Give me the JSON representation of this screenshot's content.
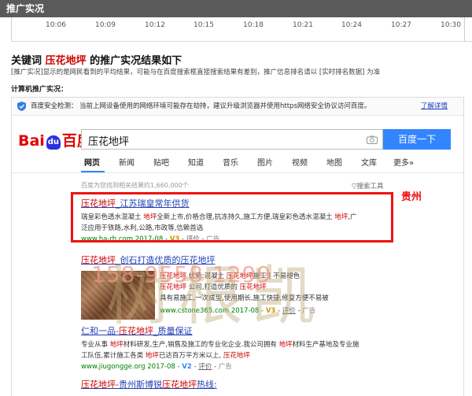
{
  "header": {
    "title": "推广实况"
  },
  "timeline": {
    "ticks": [
      "10:06",
      "10:09",
      "10:12",
      "10:15",
      "10:18",
      "10:21",
      "10:24",
      "10:27",
      "10:30"
    ]
  },
  "result_heading": {
    "prefix": "关键词 ",
    "keyword": "压花地坪",
    "suffix": " 的推广实况结果如下"
  },
  "notice": "[推广实况]显示的是网民看到的平均结果，可能与在百度搜索框直接搜索结果有差别，推广信息排名请以 [实时排名数据] 为准",
  "subheading": "计算机推广实况：",
  "security_bar": {
    "label": "百度安全检测：",
    "message": "当前上网设备使用的网络环境可能存在劫持，建议升级浏览器并使用https网络安全协议访问百度。",
    "link": "了解详情"
  },
  "baidu": {
    "logo_bai": "Bai",
    "logo_du": "du",
    "logo_cn": "百度",
    "query": "压花地坪",
    "search_button": "百度一下",
    "tabs": [
      "网页",
      "新闻",
      "贴吧",
      "知道",
      "音乐",
      "图片",
      "视频",
      "地图",
      "文库",
      "更多»"
    ],
    "result_count": "百度为您找到相关结果约1,660,000个",
    "search_tools": "搜索工具"
  },
  "annotation": {
    "region_label": "贵州"
  },
  "watermark": {
    "text": "树根凯",
    "phone": "158-9558-1299"
  },
  "results": [
    {
      "title_hl": "压花地坪",
      "title_rest": "_江苏瑞皇常年供货",
      "desc1_a": "瑞皇彩色透水混凝土 ",
      "desc1_hl": "地坪",
      "desc1_b": "全新上市,价格合理,抗冻持久,施工方便,瑞皇彩色透水混凝土 ",
      "desc1_hl2": "地坪",
      "desc1_c": ",广",
      "desc2": "泛应用于铁路,水利,公路,市政等,信赖首选",
      "url": "www.ha-rh.com",
      "date": "2017-08",
      "vbadge": "V3",
      "eval": "评价",
      "ad": "广告"
    },
    {
      "title_hl": "压花地坪",
      "title_rest": "_创石打造优质的压花地坪",
      "desc1_a": "",
      "desc1_hl": "压花地坪",
      "desc1_b": " 优势:混凝土 ",
      "desc1_hl2": "压花地坪",
      "desc1_c": "施工 | 不易褪色",
      "desc2_hl": "压花地坪",
      "desc2": " 公司,打造优质的 ",
      "desc2_hl2": "压花地坪",
      "desc3": "具有易施工,一次成型,使用期长,施工快捷,修复方便不易被",
      "url": "www.cstone365.com",
      "date": "2017-08",
      "vbadge": "V3",
      "eval": "评价",
      "ad": "广告"
    },
    {
      "title_a": "仁和一品-",
      "title_hl": "压花地坪",
      "title_rest": "_质量保证",
      "desc1_a": "专业从事 ",
      "desc1_hl": "地坪",
      "desc1_b": "材料研发,生产,销售及施工的专业化企业.我公司拥有 ",
      "desc1_hl2": "地坪",
      "desc1_c": "材料生产基地及专业施",
      "desc2": "工队伍,累计施工各类 ",
      "desc2_hl": "地坪",
      "desc2_b": "已达百万平方米以上, ",
      "desc2_hl2": "压花地坪",
      "url": "www.jiugongge.org",
      "date": "2017-08",
      "vbadge": "V2",
      "eval": "评价",
      "ad": "广告"
    },
    {
      "title_hl": "压花地坪",
      "title_mid": "-贵州斯博锐",
      "title_hl2": "压花地坪",
      "title_rest": "热线:"
    }
  ]
}
